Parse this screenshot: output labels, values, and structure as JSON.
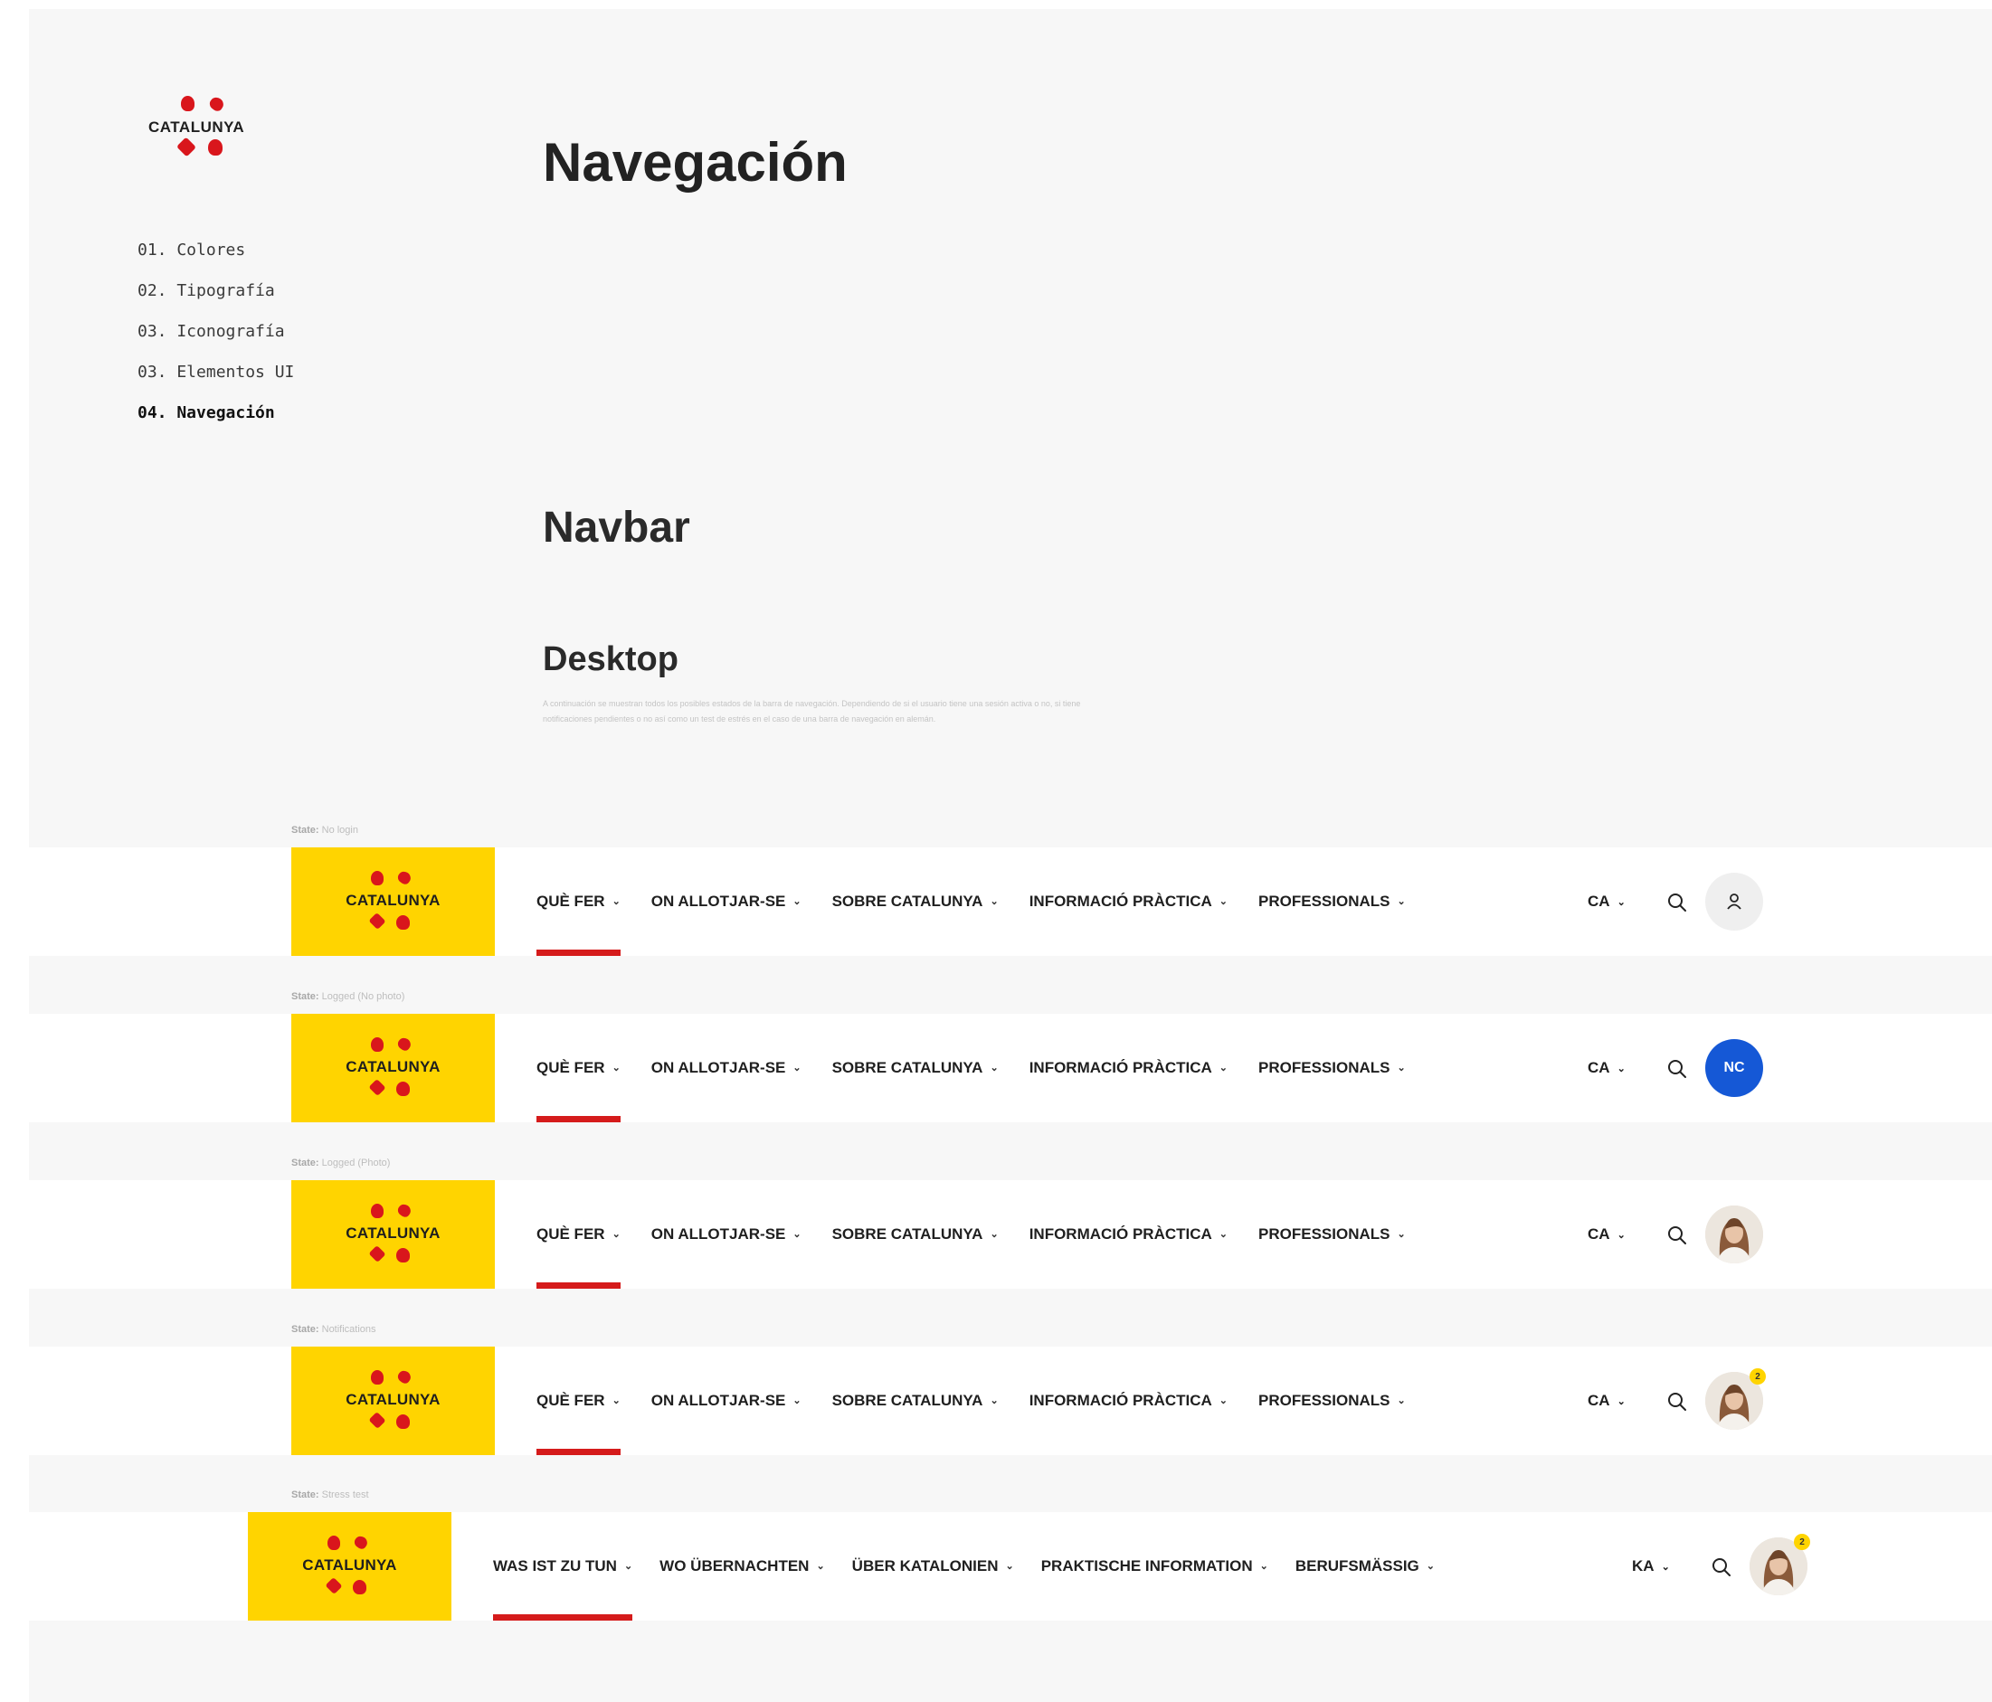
{
  "sidebar": {
    "logo_text": "CATALUNYA",
    "items": [
      {
        "label": "01. Colores"
      },
      {
        "label": "02. Tipografía"
      },
      {
        "label": "03. Iconografía"
      },
      {
        "label": "03. Elementos UI"
      },
      {
        "label": "04. Navegación",
        "active": true
      }
    ]
  },
  "main": {
    "title": "Navegación",
    "section": "Navbar",
    "subsection": "Desktop",
    "description": "A continuación se muestran todos los posibles estados de la barra de navegación. Dependiendo de si el usuario tiene una sesión activa o no, si tiene notificaciones pendientes o no así como un test de estrés en el caso de una barra de navegación en alemán."
  },
  "navbars": [
    {
      "state_label": "State:",
      "state_value": "No login",
      "logo_text": "CATALUNYA",
      "menu": [
        "QUÈ FER",
        "ON ALLOTJAR-SE",
        "SOBRE CATALUNYA",
        "INFORMACIÓ PRÀCTICA",
        "PROFESSIONALS"
      ],
      "lang": "CA",
      "avatar": {
        "type": "icon",
        "icon": "user-icon"
      }
    },
    {
      "state_label": "State:",
      "state_value": "Logged (No photo)",
      "logo_text": "CATALUNYA",
      "menu": [
        "QUÈ FER",
        "ON ALLOTJAR-SE",
        "SOBRE CATALUNYA",
        "INFORMACIÓ PRÀCTICA",
        "PROFESSIONALS"
      ],
      "lang": "CA",
      "avatar": {
        "type": "initials",
        "initials": "NC",
        "color": "#1558d6"
      }
    },
    {
      "state_label": "State:",
      "state_value": "Logged (Photo)",
      "logo_text": "CATALUNYA",
      "menu": [
        "QUÈ FER",
        "ON ALLOTJAR-SE",
        "SOBRE CATALUNYA",
        "INFORMACIÓ PRÀCTICA",
        "PROFESSIONALS"
      ],
      "lang": "CA",
      "avatar": {
        "type": "photo"
      }
    },
    {
      "state_label": "State:",
      "state_value": "Notifications",
      "logo_text": "CATALUNYA",
      "menu": [
        "QUÈ FER",
        "ON ALLOTJAR-SE",
        "SOBRE CATALUNYA",
        "INFORMACIÓ PRÀCTICA",
        "PROFESSIONALS"
      ],
      "lang": "CA",
      "avatar": {
        "type": "photo",
        "badge": "2"
      }
    },
    {
      "state_label": "State:",
      "state_value": "Stress test",
      "logo_text": "CATALUNYA",
      "menu": [
        "WAS IST ZU TUN",
        "WO ÜBERNACHTEN",
        "ÜBER KATALONIEN",
        "PRAKTISCHE INFORMATION",
        "BERUFSMÄSSIG"
      ],
      "lang": "KA",
      "avatar": {
        "type": "photo",
        "badge": "2"
      }
    }
  ],
  "colors": {
    "brand_yellow": "#ffd400",
    "brand_red": "#d9161c",
    "active_underline": "#d51b1b",
    "avatar_blue": "#1558d6",
    "page_background": "#f7f7f7"
  }
}
